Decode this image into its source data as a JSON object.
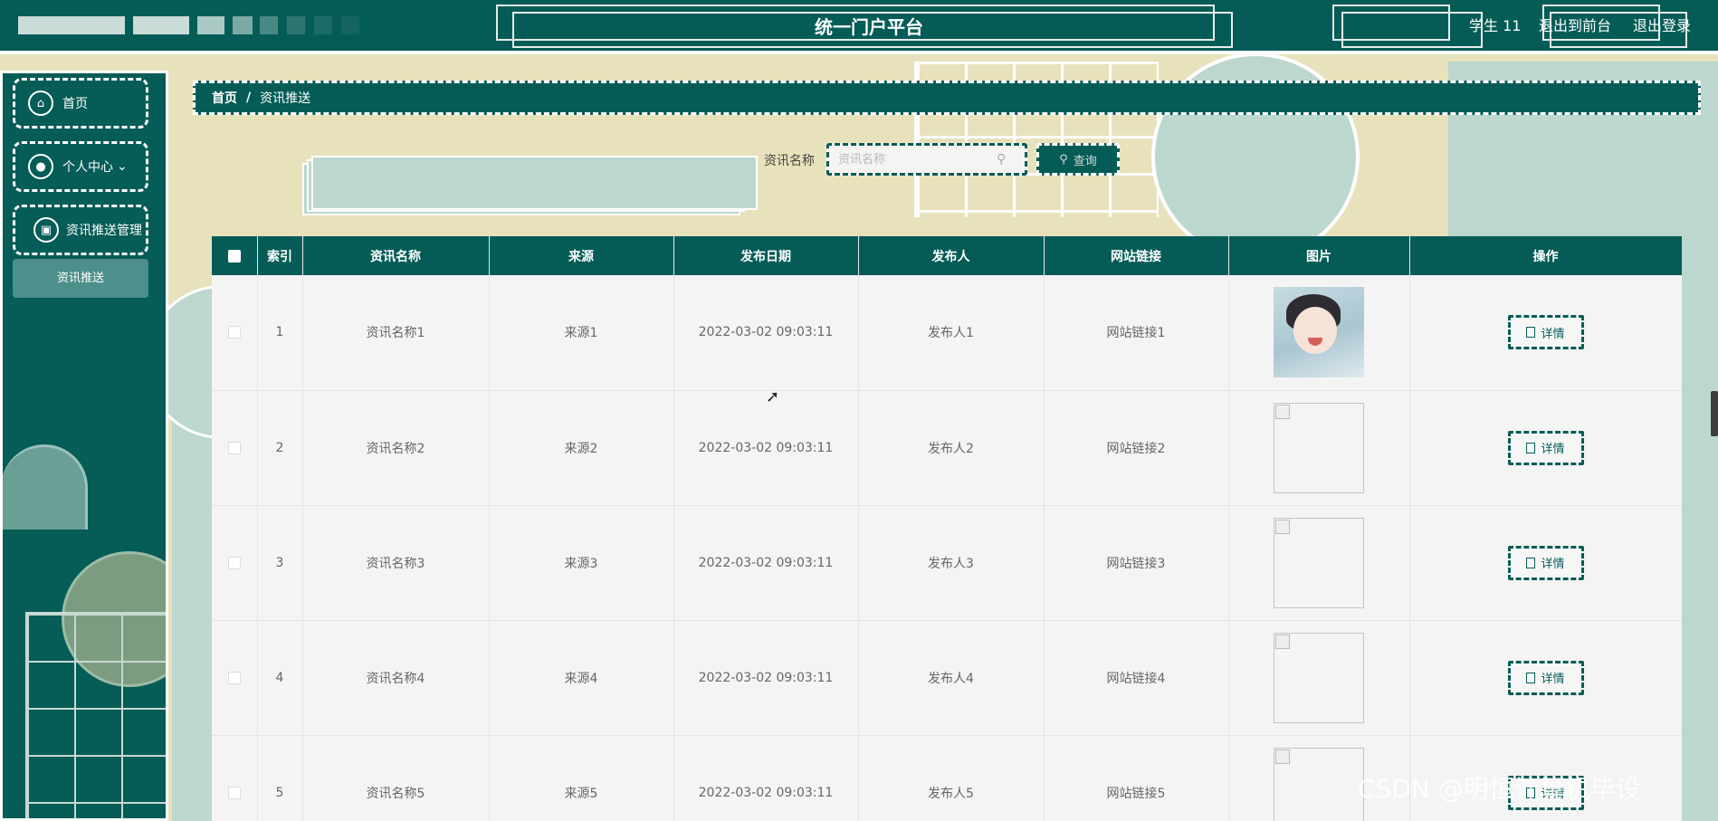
{
  "header": {
    "title": "统一门户平台",
    "user": "学生 11",
    "links": [
      "退出到前台",
      "退出登录"
    ]
  },
  "sidebar": {
    "items": [
      {
        "label": "首页",
        "icon": "home-icon"
      },
      {
        "label": "个人中心",
        "icon": "user-icon",
        "caret": "⌄"
      },
      {
        "label": "资讯推送管理",
        "icon": "news-icon"
      }
    ],
    "submenu": {
      "label": "资讯推送"
    }
  },
  "breadcrumb": {
    "home": "首页",
    "separator": "/",
    "current": "资讯推送"
  },
  "search": {
    "label": "资讯名称",
    "placeholder": "资讯名称",
    "button": "查询"
  },
  "table": {
    "headers": [
      "索引",
      "资讯名称",
      "来源",
      "发布日期",
      "发布人",
      "网站链接",
      "图片",
      "操作"
    ],
    "rows": [
      {
        "index": "1",
        "name": "资讯名称1",
        "source": "来源1",
        "date": "2022-03-02 09:03:11",
        "publisher": "发布人1",
        "link": "网站链接1",
        "image": "avatar"
      },
      {
        "index": "2",
        "name": "资讯名称2",
        "source": "来源2",
        "date": "2022-03-02 09:03:11",
        "publisher": "发布人2",
        "link": "网站链接2",
        "image": "broken"
      },
      {
        "index": "3",
        "name": "资讯名称3",
        "source": "来源3",
        "date": "2022-03-02 09:03:11",
        "publisher": "发布人3",
        "link": "网站链接3",
        "image": "broken"
      },
      {
        "index": "4",
        "name": "资讯名称4",
        "source": "来源4",
        "date": "2022-03-02 09:03:11",
        "publisher": "发布人4",
        "link": "网站链接4",
        "image": "broken"
      },
      {
        "index": "5",
        "name": "资讯名称5",
        "source": "来源5",
        "date": "2022-03-02 09:03:11",
        "publisher": "发布人5",
        "link": "网站链接5",
        "image": "broken"
      }
    ],
    "detail_label": "详情"
  },
  "watermark": "CSDN @明恒计算机毕设",
  "colors": {
    "primary": "#055c57",
    "accent_light": "#bcd7ce",
    "background": "#e8e2bc"
  }
}
